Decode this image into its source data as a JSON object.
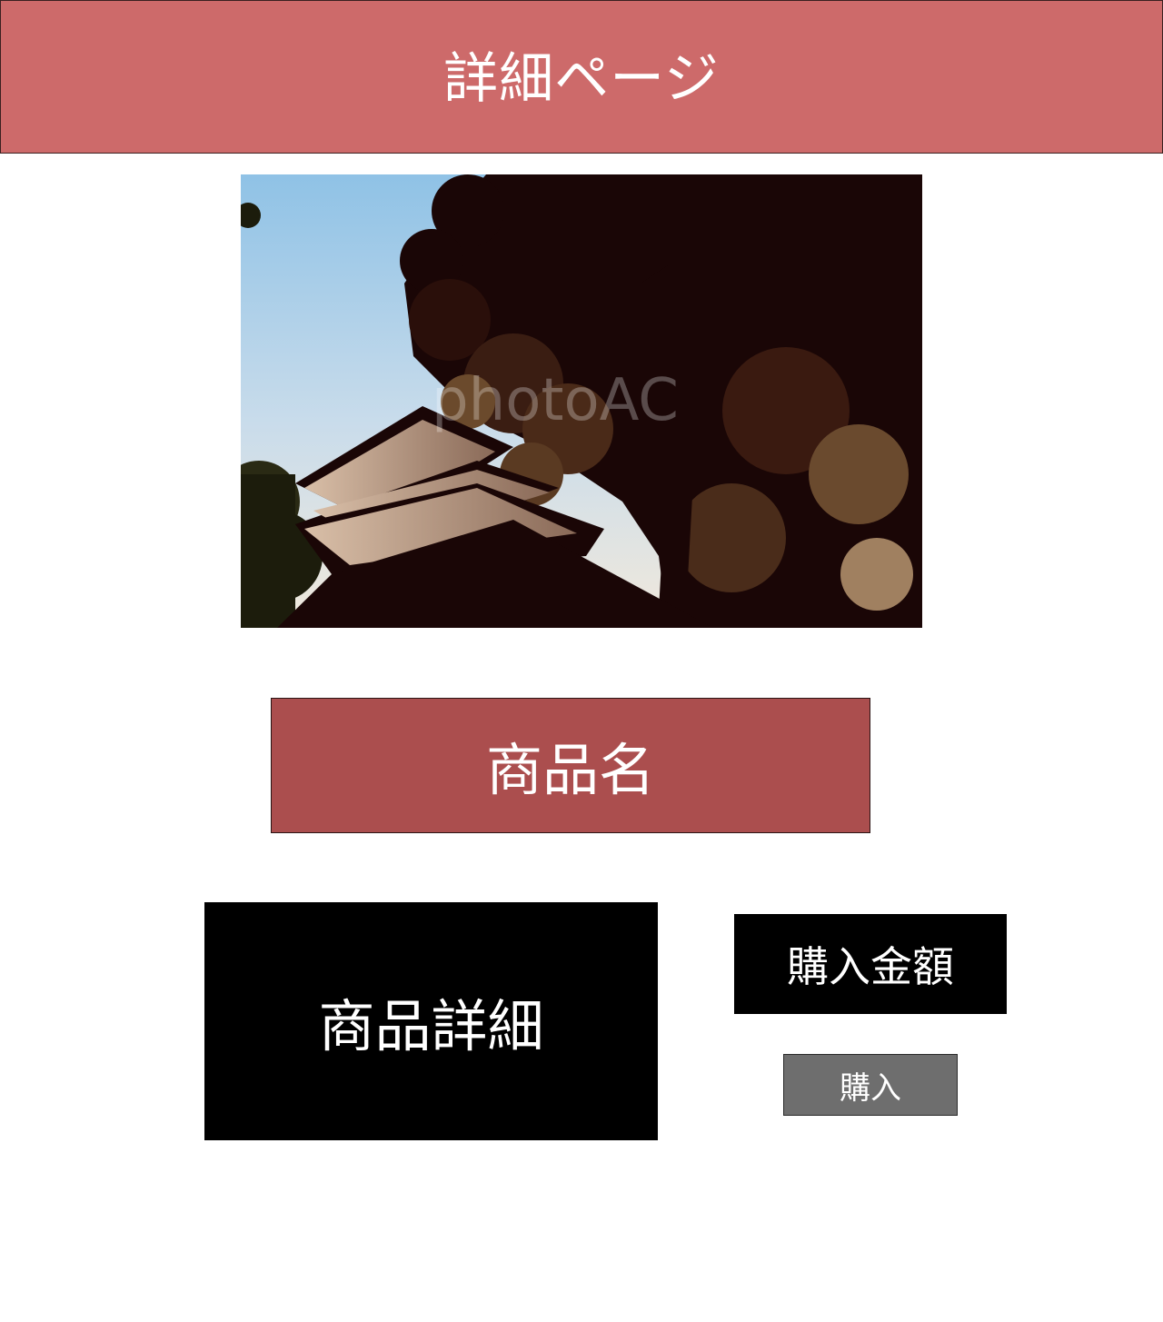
{
  "header": {
    "title": "詳細ページ"
  },
  "product": {
    "image_icon": "book-stack-under-tree-photo",
    "watermark": "photoAC",
    "name_label": "商品名",
    "detail_label": "商品詳細",
    "price_label": "購入金額",
    "buy_label": "購入"
  },
  "colors": {
    "header_bg": "#cd6a6a",
    "name_bg": "#ab4e4e",
    "detail_bg": "#000000",
    "buy_bg": "#6e6e6e"
  }
}
